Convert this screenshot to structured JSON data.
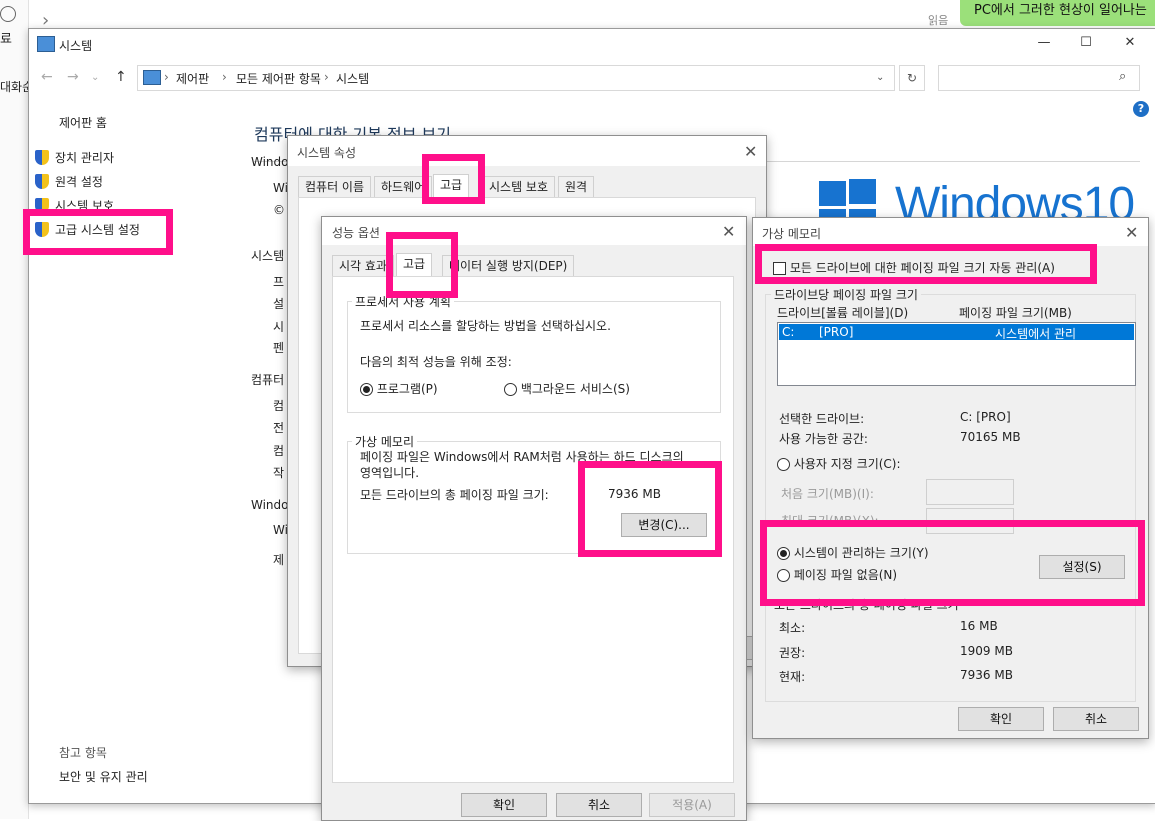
{
  "background": {
    "chat_bubble": "PC에서 그러한 현상이 일어나는",
    "read_label": "읽음",
    "left_frag1": "료",
    "left_frag2": "대화순"
  },
  "window": {
    "title": "시스템",
    "breadcrumbs": [
      "제어판",
      "모든 제어판 항목",
      "시스템"
    ],
    "search_placeholder": ""
  },
  "sidebar": {
    "home": "제어판 홈",
    "items": [
      {
        "label": "장치 관리자",
        "icon": "shield-icon"
      },
      {
        "label": "원격 설정",
        "icon": "shield-icon"
      },
      {
        "label": "시스템 보호",
        "icon": "shield-icon"
      },
      {
        "label": "고급 시스템 설정",
        "icon": "shield-icon"
      }
    ],
    "see_also": "참고 항목",
    "security": "보안 및 유지 관리"
  },
  "main": {
    "title": "컴퓨터에 대한 기본 정보 보기",
    "frags": [
      "Windo",
      "Wi",
      "©",
      "시스템",
      "프",
      "설",
      "시",
      "펜",
      "컴퓨터",
      "컴",
      "전",
      "컴",
      "작",
      "Windo",
      "Wi",
      "제"
    ],
    "logo_text": "Windows10"
  },
  "sys_props": {
    "title": "시스템 속성",
    "tabs": [
      "컴퓨터 이름",
      "하드웨어",
      "고급",
      "시스템 보호",
      "원격"
    ]
  },
  "perf": {
    "title": "성능 옵션",
    "tabs": [
      "시각 효과",
      "고급",
      "데이터 실행 방지(DEP)"
    ],
    "proc_group": "프로세서 사용 계획",
    "proc_desc": "프로세서 리소스를 할당하는 방법을 선택하십시오.",
    "adjust_label": "다음의 최적 성능을 위해 조정:",
    "radio_program": "프로그램(P)",
    "radio_background": "백그라운드 서비스(S)",
    "vm_group": "가상 메모리",
    "vm_desc1": "페이징 파일은 Windows에서 RAM처럼 사용하는 하드 디스크의",
    "vm_desc2": "영역입니다.",
    "total_label": "모든 드라이브의 총 페이징 파일 크기:",
    "total_value": "7936 MB",
    "change_btn": "변경(C)...",
    "ok": "확인",
    "cancel": "취소",
    "apply": "적용(A)"
  },
  "vm": {
    "title": "가상 메모리",
    "auto_manage": "모든 드라이브에 대한 페이징 파일 크기 자동 관리(A)",
    "drive_group": "드라이브당 페이징 파일 크기",
    "col_drive": "드라이브[볼륨 레이블](D)",
    "col_size": "페이징 파일 크기(MB)",
    "row_drive": "C:",
    "row_label": "[PRO]",
    "row_size": "시스템에서 관리",
    "selected_label": "선택한 드라이브:",
    "selected_value": "C:  [PRO]",
    "avail_label": "사용 가능한 공간:",
    "avail_value": "70165 MB",
    "custom_size": "사용자 지정 크기(C):",
    "initial_label": "처음 크기(MB)(I):",
    "max_label": "최대 크기(MB)(X):",
    "system_managed": "시스템이 관리하는 크기(Y)",
    "no_paging": "페이징 파일 없음(N)",
    "set_btn": "설정(S)",
    "total_group": "모든 드라이브의 총 페이징 파일 크기",
    "min_label": "최소:",
    "min_value": "16 MB",
    "rec_label": "권장:",
    "rec_value": "1909 MB",
    "cur_label": "현재:",
    "cur_value": "7936 MB",
    "ok": "확인",
    "cancel": "취소"
  }
}
